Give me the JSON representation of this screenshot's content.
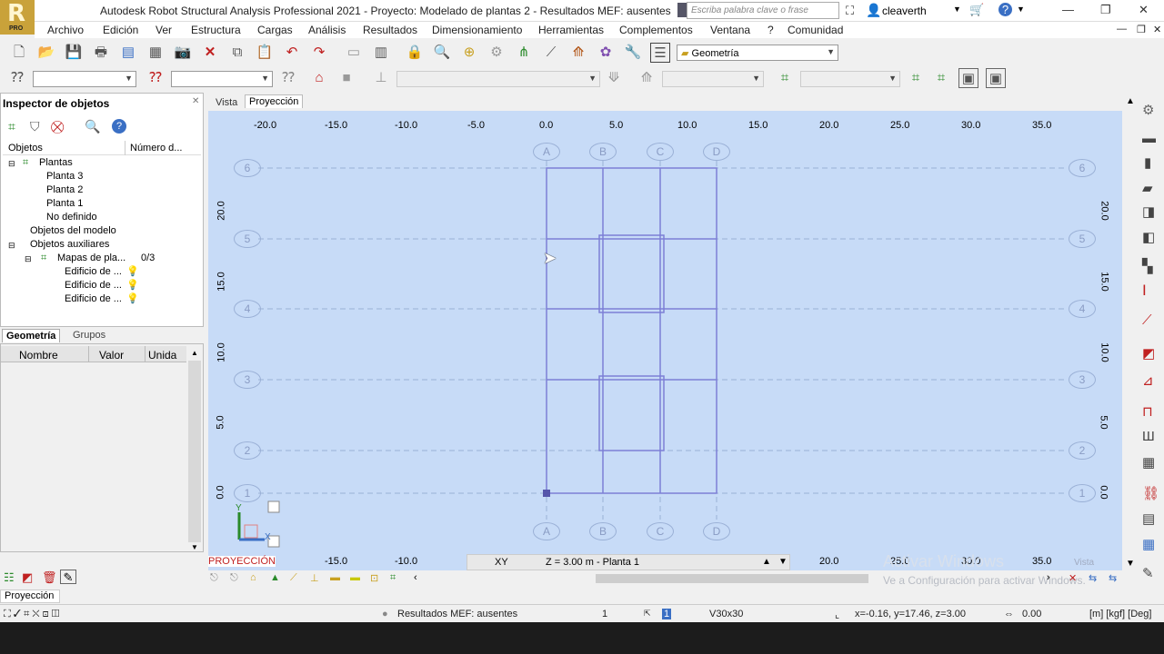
{
  "app": {
    "title": "Autodesk Robot Structural Analysis Professional 2021 - Proyecto: Modelado de plantas 2 - Resultados MEF: ausentes",
    "search_placeholder": "Escriba palabra clave o frase",
    "user": "cleaverth",
    "logo_letter": "R",
    "logo_sub": "PRO"
  },
  "menu": [
    "Archivo",
    "Edición",
    "Ver",
    "Estructura",
    "Cargas",
    "Análisis",
    "Resultados",
    "Dimensionamiento",
    "Herramientas",
    "Complementos",
    "Ventana",
    "?",
    "Comunidad"
  ],
  "toolbar": {
    "layout_combo": "Geometría"
  },
  "inspector": {
    "title": "Inspector de objetos",
    "col_objects": "Objetos",
    "col_number": "Número d...",
    "tree": {
      "plantas": "Plantas",
      "planta3": "Planta 3",
      "planta2": "Planta 2",
      "planta1": "Planta 1",
      "no_definido": "No definido",
      "objetos_modelo": "Objetos del modelo",
      "objetos_aux": "Objetos auxiliares",
      "mapas": "Mapas de pla...",
      "mapas_count": "0/3",
      "edificio1": "Edificio de ...",
      "edificio2": "Edificio de ...",
      "edificio3": "Edificio de ..."
    },
    "tab_geometria": "Geometría",
    "tab_grupos": "Grupos"
  },
  "props": {
    "col_nombre": "Nombre",
    "col_valor": "Valor",
    "col_unidad": "Unida"
  },
  "view": {
    "tab_vista": "Vista",
    "tab_proyeccion": "Proyección",
    "x_ticks": [
      "-20.0",
      "-15.0",
      "-10.0",
      "-5.0",
      "0.0",
      "5.0",
      "10.0",
      "15.0",
      "20.0",
      "25.0",
      "30.0",
      "35.0"
    ],
    "y_ticks": [
      "20.0",
      "15.0",
      "10.0",
      "5.0",
      "0.0"
    ],
    "axis_letters": [
      "A",
      "B",
      "C",
      "D"
    ],
    "axis_numbers": [
      "6",
      "5",
      "4",
      "3",
      "2",
      "1"
    ],
    "plane": "XY",
    "level": "Z = 3.00 m - Planta 1",
    "projection_label": "PROYECCIÓN",
    "watermark1": "Activar Windows",
    "watermark2": "Ve a Configuración para activar Windows.",
    "vista_label": "Vista"
  },
  "statusbar": {
    "panel_label": "Proyección",
    "results": "Resultados MEF: ausentes",
    "number": "1",
    "section": "V30x30",
    "coords": "x=-0.16, y=17.46, z=3.00",
    "value": "0.00",
    "units": "[m] [kgf] [Deg]"
  }
}
